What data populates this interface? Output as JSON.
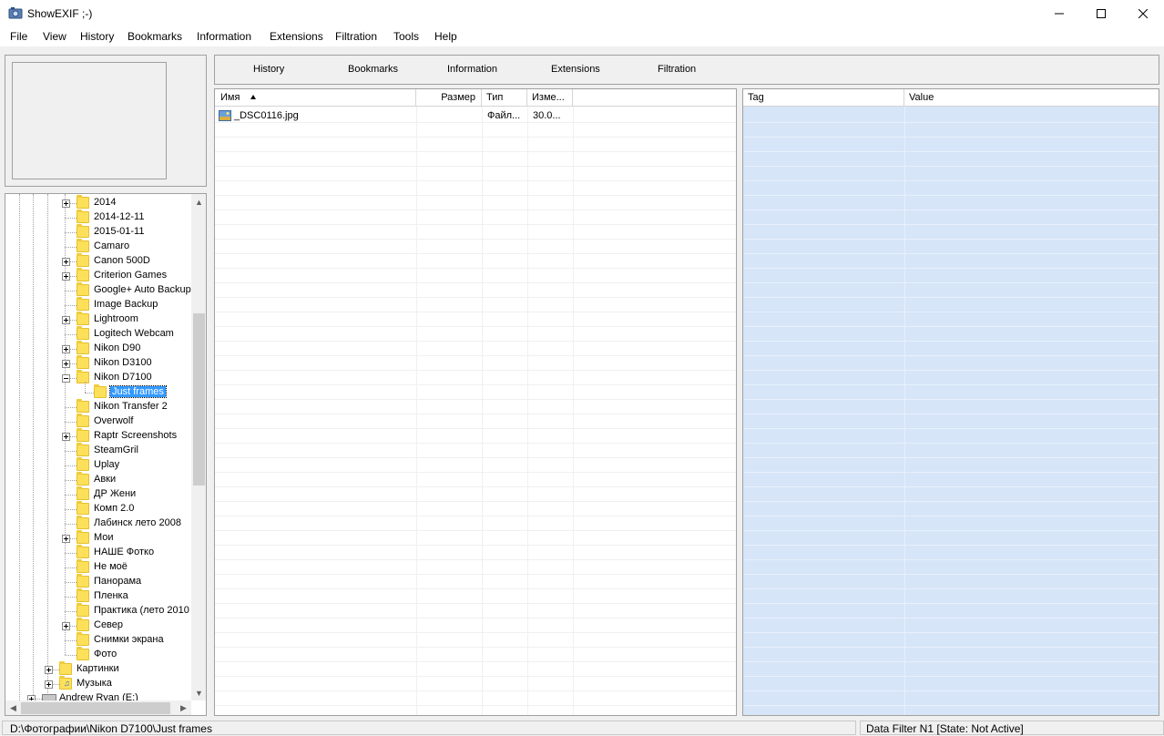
{
  "window": {
    "title": "ShowEXIF ;-)",
    "minimize_label": "—",
    "maximize_label": "☐",
    "close_label": "✕"
  },
  "menubar": {
    "items": [
      "File",
      "View",
      "History",
      "Bookmarks",
      "Information",
      "Extensions",
      "Filtration",
      "Tools",
      "Help"
    ]
  },
  "tabs": [
    "History",
    "Bookmarks",
    "Information",
    "Extensions",
    "Filtration"
  ],
  "folder_tree": {
    "selected": "Just frames",
    "items": [
      {
        "label": "2014",
        "expandable": true,
        "expanded": false
      },
      {
        "label": "2014-12-11",
        "expandable": false
      },
      {
        "label": "2015-01-11",
        "expandable": false
      },
      {
        "label": "Camaro",
        "expandable": false
      },
      {
        "label": "Canon 500D",
        "expandable": true,
        "expanded": false
      },
      {
        "label": "Criterion Games",
        "expandable": true,
        "expanded": false
      },
      {
        "label": "Google+ Auto Backup",
        "expandable": false
      },
      {
        "label": "Image Backup",
        "expandable": false
      },
      {
        "label": "Lightroom",
        "expandable": true,
        "expanded": false
      },
      {
        "label": "Logitech Webcam",
        "expandable": false
      },
      {
        "label": "Nikon D90",
        "expandable": true,
        "expanded": false
      },
      {
        "label": "Nikon D3100",
        "expandable": true,
        "expanded": false
      },
      {
        "label": "Nikon D7100",
        "expandable": true,
        "expanded": true
      },
      {
        "label": "Just frames",
        "expandable": false,
        "child": true,
        "selected": true
      },
      {
        "label": "Nikon Transfer 2",
        "expandable": false
      },
      {
        "label": "Overwolf",
        "expandable": false
      },
      {
        "label": "Raptr Screenshots",
        "expandable": true,
        "expanded": false
      },
      {
        "label": "SteamGril",
        "expandable": false
      },
      {
        "label": "Uplay",
        "expandable": false
      },
      {
        "label": "Авки",
        "expandable": false
      },
      {
        "label": "ДР Жени",
        "expandable": false
      },
      {
        "label": "Комп 2.0",
        "expandable": false
      },
      {
        "label": "Лабинск лето 2008",
        "expandable": false
      },
      {
        "label": "Мои",
        "expandable": true,
        "expanded": false
      },
      {
        "label": "НАШЕ Фотко",
        "expandable": false
      },
      {
        "label": "Не моё",
        "expandable": false
      },
      {
        "label": "Панорама",
        "expandable": false
      },
      {
        "label": "Пленка",
        "expandable": false
      },
      {
        "label": "Практика (лето 2010",
        "expandable": false
      },
      {
        "label": "Север",
        "expandable": true,
        "expanded": false
      },
      {
        "label": "Снимки экрана",
        "expandable": false
      },
      {
        "label": "Фото",
        "expandable": false
      },
      {
        "label": "Картинки",
        "expandable": true,
        "expanded": false,
        "upper": true
      },
      {
        "label": "Музыка",
        "expandable": true,
        "expanded": false,
        "upper": true,
        "icon": "music-folder-icon"
      },
      {
        "label": "Andrew Ryan (E:)",
        "expandable": true,
        "expanded": false,
        "drive": true
      }
    ]
  },
  "file_list": {
    "columns": [
      {
        "label": "Имя",
        "sort": "ascending"
      },
      {
        "label": "Размер"
      },
      {
        "label": "Тип"
      },
      {
        "label": "Изме..."
      }
    ],
    "rows": [
      {
        "name": "_DSC0116.jpg",
        "size": "",
        "type": "Файл...",
        "modified": "30.0..."
      }
    ]
  },
  "exif_panel": {
    "columns": [
      "Tag",
      "Value"
    ]
  },
  "statusbar": {
    "path": "D:\\Фотографии\\Nikon D7100\\Just frames",
    "filter_state": "Data Filter N1 [State: Not Active]"
  },
  "colors": {
    "selection": "#3399ff",
    "folder": "#fde05a",
    "exif_panel_bg": "#d6e5f8"
  }
}
